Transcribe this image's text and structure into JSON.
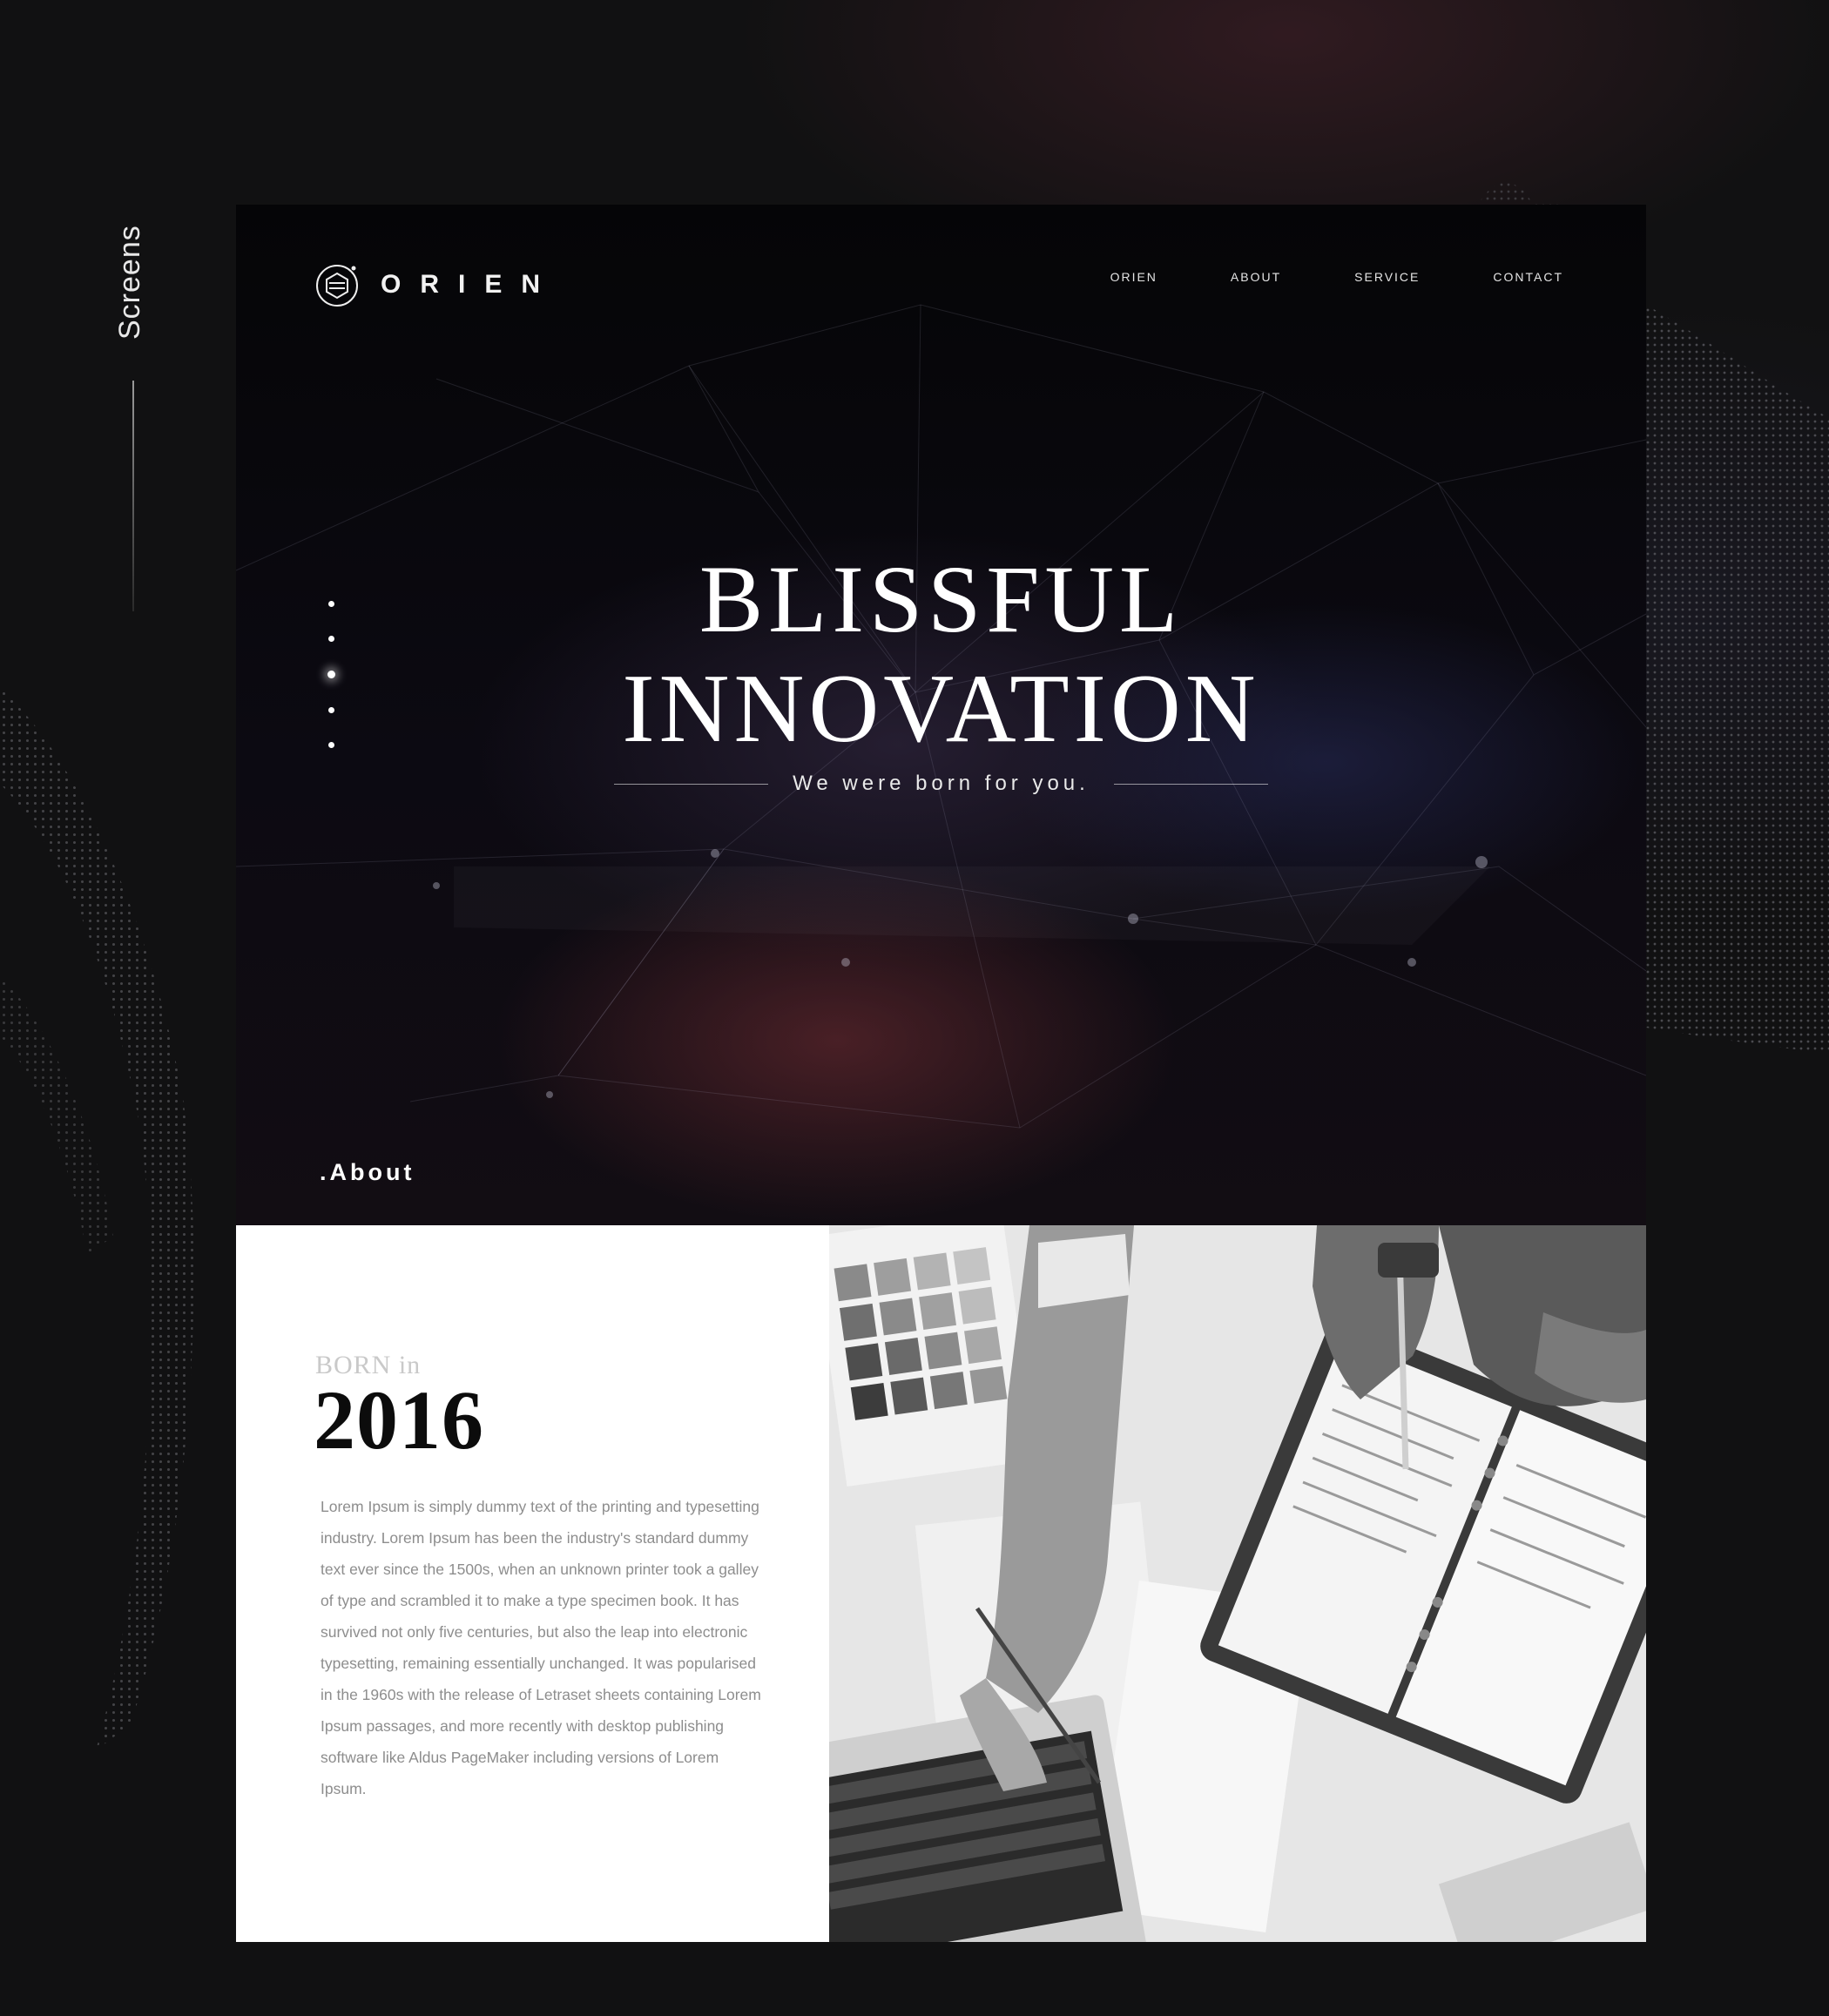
{
  "presentation": {
    "side_label": "Screens"
  },
  "brand": {
    "logo_icon": "orien-logo-icon",
    "name": "ORIEN"
  },
  "nav": {
    "items": [
      {
        "label": "ORIEN"
      },
      {
        "label": "ABOUT"
      },
      {
        "label": "SERVICE"
      },
      {
        "label": "CONTACT"
      }
    ]
  },
  "hero": {
    "title_line1": "BLISSFUL",
    "title_line2": "INNOVATION",
    "tagline": "We were born for you.",
    "slide_count": 5,
    "active_slide": 3,
    "section_label": ".About"
  },
  "about": {
    "born_label": "BORN in",
    "year": "2016",
    "paragraph": "Lorem Ipsum is simply dummy text of the printing and typesetting industry. Lorem Ipsum has been the industry's standard dummy text ever since the 1500s, when an unknown printer took a galley of type and scrambled it to make a type specimen book. It has survived not only five centuries, but also the leap into electronic typesetting, remaining essentially unchanged. It was popularised in the 1960s with the release of Letraset sheets containing Lorem Ipsum passages, and more recently with desktop publishing software like Aldus PageMaker including versions of Lorem Ipsum.",
    "photo": "team-working-at-desk-photo"
  },
  "colors": {
    "page_background": "#111112",
    "hero_background": "#07060b",
    "text_light": "#ffffff",
    "text_dark": "#0c0c0c",
    "paragraph_gray": "#8d8d8d"
  }
}
